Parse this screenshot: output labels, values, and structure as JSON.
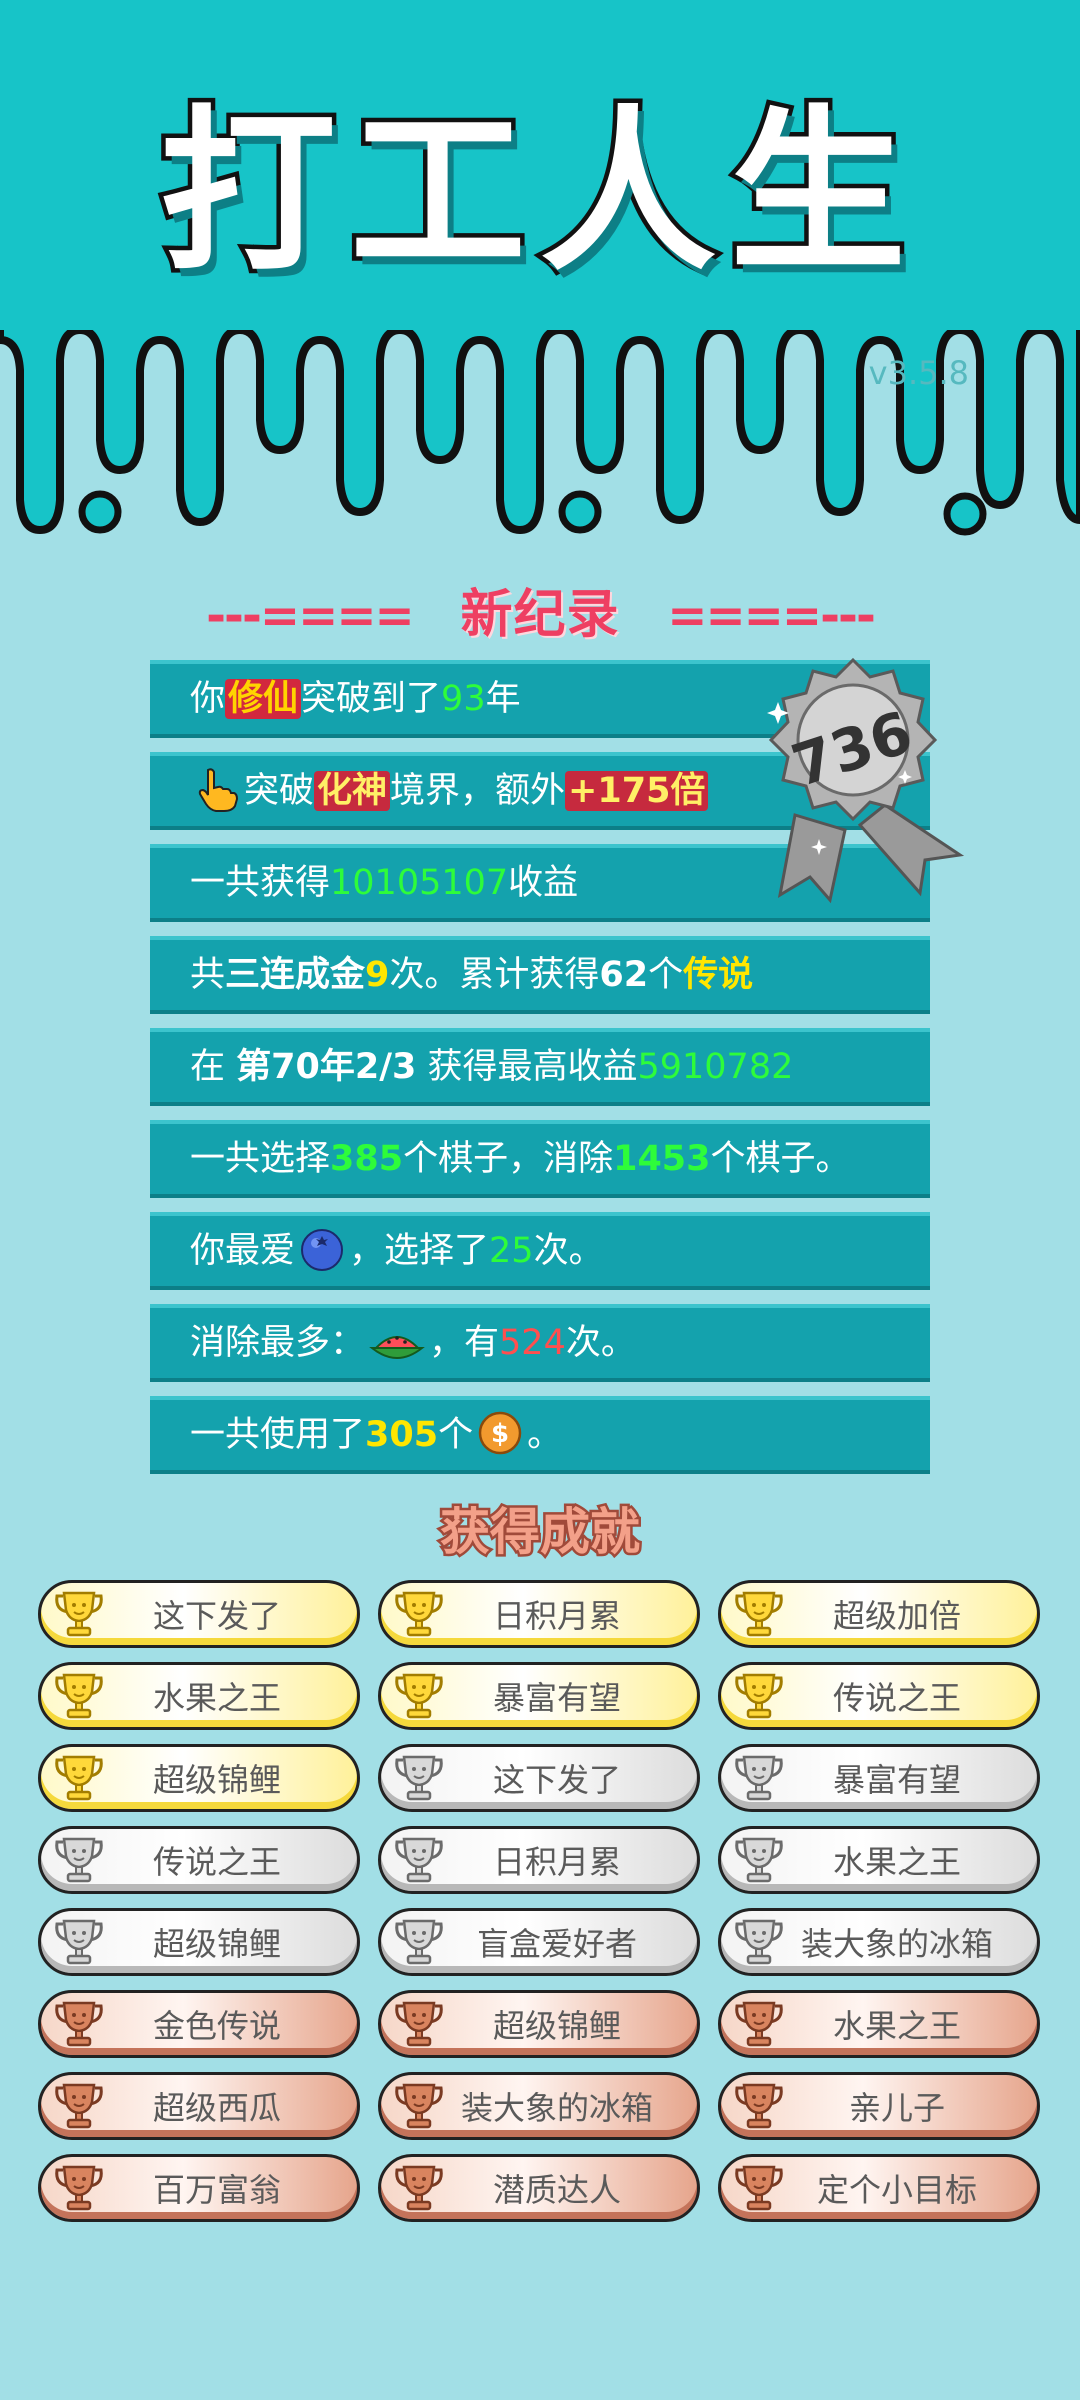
{
  "app": {
    "title": "打工人生",
    "version": "v3.5.8"
  },
  "record": {
    "left_dashes": "---====",
    "label": "新纪录",
    "right_dashes": "====---"
  },
  "medal": {
    "value": "736"
  },
  "stats": {
    "row1": {
      "a": "你",
      "b": "修仙",
      "c": "突破到了",
      "d": "93",
      "e": "年"
    },
    "row2": {
      "icon": "pointing-hand-icon",
      "a": "突破",
      "b": "化神",
      "c": "境界，额外",
      "d": "+175倍"
    },
    "row3": {
      "a": "一共获得",
      "b": "10105107",
      "c": "收益"
    },
    "row4": {
      "a": "共",
      "b": "三连成金",
      "c": "9",
      "d": "次。累计获得",
      "e": "62",
      "f": "个",
      "g": "传说"
    },
    "row5": {
      "a": "在 ",
      "b": "第70年2/3",
      "c": " 获得最高收益",
      "d": "5910782"
    },
    "row6": {
      "a": "一共选择",
      "b": "385",
      "c": "个棋子，消除",
      "d": "1453",
      "e": "个棋子。"
    },
    "row7": {
      "a": "你最爱",
      "icon": "blueberry-icon",
      "b": "，选择了",
      "c": "25",
      "d": "次。"
    },
    "row8": {
      "a": "消除最多：",
      "icon": "watermelon-icon",
      "b": "，有",
      "c": "524",
      "d": "次。"
    },
    "row9": {
      "a": "一共使用了",
      "b": "305",
      "c": "个",
      "icon": "coin-icon",
      "d": "。"
    }
  },
  "achievements": {
    "title": "获得成就",
    "items": [
      {
        "label": "这下发了",
        "tier": "gold"
      },
      {
        "label": "日积月累",
        "tier": "gold"
      },
      {
        "label": "超级加倍",
        "tier": "gold"
      },
      {
        "label": "水果之王",
        "tier": "gold"
      },
      {
        "label": "暴富有望",
        "tier": "gold"
      },
      {
        "label": "传说之王",
        "tier": "gold"
      },
      {
        "label": "超级锦鲤",
        "tier": "gold"
      },
      {
        "label": "这下发了",
        "tier": "silver"
      },
      {
        "label": "暴富有望",
        "tier": "silver"
      },
      {
        "label": "传说之王",
        "tier": "silver"
      },
      {
        "label": "日积月累",
        "tier": "silver"
      },
      {
        "label": "水果之王",
        "tier": "silver"
      },
      {
        "label": "超级锦鲤",
        "tier": "silver"
      },
      {
        "label": "盲盒爱好者",
        "tier": "silver"
      },
      {
        "label": "装大象的冰箱",
        "tier": "silver"
      },
      {
        "label": "金色传说",
        "tier": "bronze"
      },
      {
        "label": "超级锦鲤",
        "tier": "bronze"
      },
      {
        "label": "水果之王",
        "tier": "bronze"
      },
      {
        "label": "超级西瓜",
        "tier": "bronze"
      },
      {
        "label": "装大象的冰箱",
        "tier": "bronze"
      },
      {
        "label": "亲儿子",
        "tier": "bronze"
      },
      {
        "label": "百万富翁",
        "tier": "bronze"
      },
      {
        "label": "潜质达人",
        "tier": "bronze"
      },
      {
        "label": "定个小目标",
        "tier": "bronze"
      }
    ]
  },
  "colors": {
    "header_teal": "#17c4c8",
    "background": "#a2dfe6",
    "row_teal": "#14a2ad",
    "accent_red": "#ee3f62",
    "highlight_green": "#2efc3a",
    "highlight_yellow": "#ffe600"
  }
}
